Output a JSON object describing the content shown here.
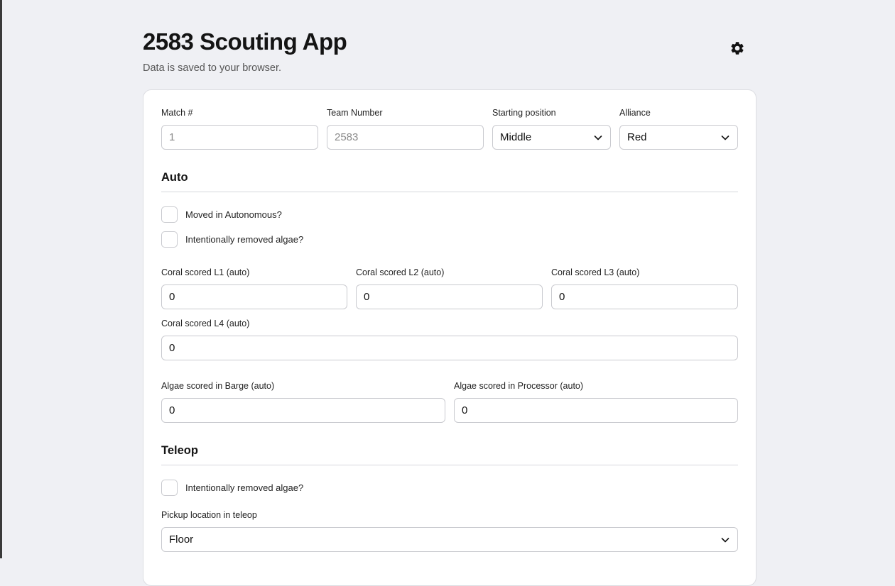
{
  "header": {
    "title": "2583 Scouting App",
    "subtitle": "Data is saved to your browser.",
    "settings_icon": "gear-icon"
  },
  "match_info": {
    "match_label": "Match #",
    "match_placeholder": "1",
    "team_label": "Team Number",
    "team_placeholder": "2583",
    "starting_position_label": "Starting position",
    "starting_position_value": "Middle",
    "alliance_label": "Alliance",
    "alliance_value": "Red"
  },
  "auto": {
    "title": "Auto",
    "moved_label": "Moved in Autonomous?",
    "removed_algae_label": "Intentionally removed algae?",
    "coral_l1_label": "Coral scored L1 (auto)",
    "coral_l1_value": "0",
    "coral_l2_label": "Coral scored L2 (auto)",
    "coral_l2_value": "0",
    "coral_l3_label": "Coral scored L3 (auto)",
    "coral_l3_value": "0",
    "coral_l4_label": "Coral scored L4 (auto)",
    "coral_l4_value": "0",
    "algae_barge_label": "Algae scored in Barge (auto)",
    "algae_barge_value": "0",
    "algae_processor_label": "Algae scored in Processor (auto)",
    "algae_processor_value": "0"
  },
  "teleop": {
    "title": "Teleop",
    "removed_algae_label": "Intentionally removed algae?",
    "pickup_label": "Pickup location in teleop",
    "pickup_value": "Floor"
  }
}
